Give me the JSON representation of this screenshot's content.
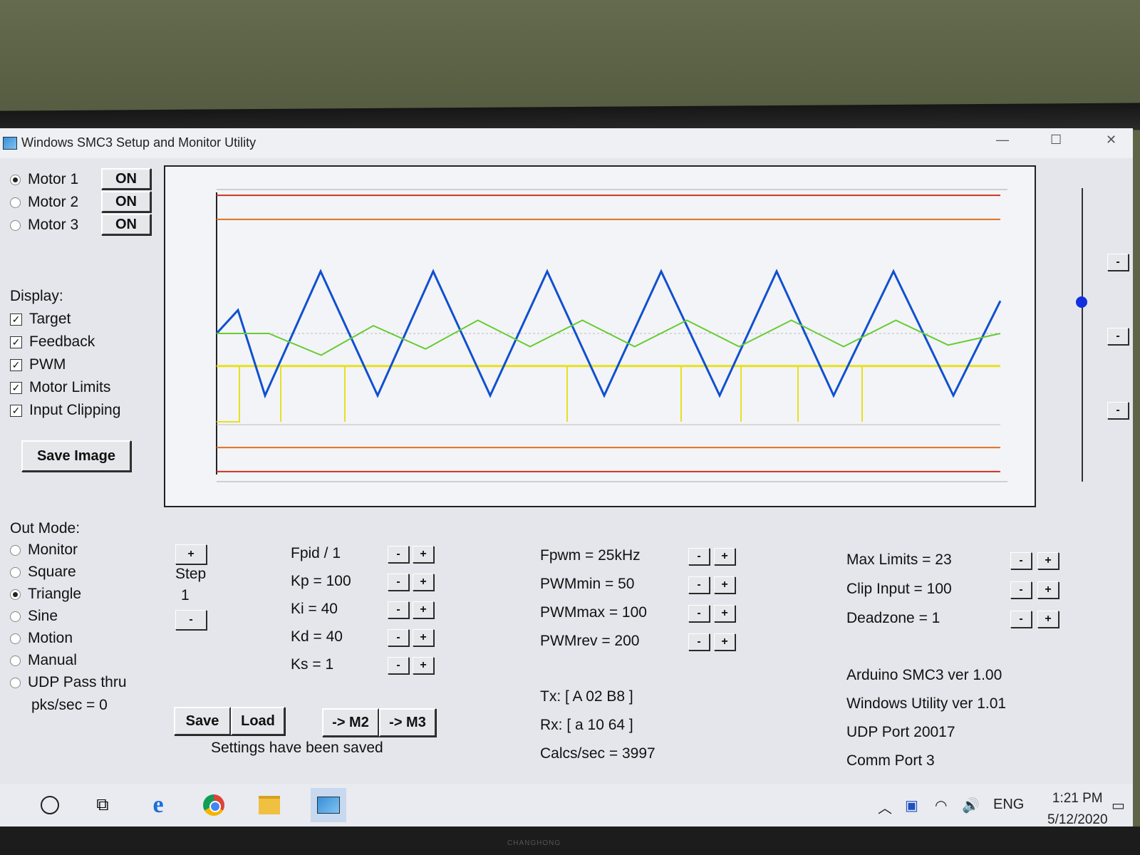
{
  "window": {
    "title": "Windows SMC3 Setup and Monitor Utility"
  },
  "motors": [
    {
      "label": "Motor 1",
      "selected": true,
      "button": "ON"
    },
    {
      "label": "Motor 2",
      "selected": false,
      "button": "ON"
    },
    {
      "label": "Motor 3",
      "selected": false,
      "button": "ON"
    }
  ],
  "display": {
    "heading": "Display:",
    "options": [
      {
        "label": "Target",
        "checked": true
      },
      {
        "label": "Feedback",
        "checked": true
      },
      {
        "label": "PWM",
        "checked": true
      },
      {
        "label": "Motor Limits",
        "checked": true
      },
      {
        "label": "Input Clipping",
        "checked": true
      }
    ],
    "save_image": "Save Image"
  },
  "out_mode": {
    "heading": "Out Mode:",
    "options": [
      {
        "label": "Monitor",
        "selected": false
      },
      {
        "label": "Square",
        "selected": false
      },
      {
        "label": "Triangle",
        "selected": true
      },
      {
        "label": "Sine",
        "selected": false
      },
      {
        "label": "Motion",
        "selected": false
      },
      {
        "label": "Manual",
        "selected": false
      },
      {
        "label": "UDP Pass thru",
        "selected": false
      }
    ],
    "pks": "pks/sec = 0"
  },
  "step": {
    "plus": "+",
    "label": "Step",
    "value": "1",
    "minus": "-"
  },
  "pid": [
    "Fpid / 1",
    "Kp = 100",
    "Ki = 40",
    "Kd = 40",
    "Ks = 1"
  ],
  "pwm": [
    "Fpwm = 25kHz",
    "PWMmin = 50",
    "PWMmax = 100",
    "PWMrev = 200"
  ],
  "limits": [
    "Max Limits = 23",
    "Clip Input = 100",
    "Deadzone = 1"
  ],
  "controls": {
    "minus": "-",
    "plus": "+"
  },
  "buttons": {
    "save": "Save",
    "load": "Load",
    "m2": "-> M2",
    "m3": "-> M3"
  },
  "status": "Settings have been saved",
  "comms": {
    "tx": "Tx: [ A 02 B8 ]",
    "rx": "Rx: [ a 10 64 ]",
    "calcs": "Calcs/sec = 3997"
  },
  "info": [
    "Arduino SMC3 ver 1.00",
    "Windows Utility ver 1.01",
    "UDP Port 20017",
    "Comm Port 3"
  ],
  "chart_data": {
    "type": "line",
    "series": [
      {
        "color": "#1050d0",
        "values": [
          0.0,
          0.3,
          -0.8,
          0.8,
          -0.8,
          0.8,
          -0.8,
          0.8,
          -0.8,
          0.8,
          -0.8,
          0.8,
          -0.8,
          0.42
        ]
      },
      {
        "color": "#66cc33",
        "values": [
          0.0,
          0.0,
          -0.28,
          0.1,
          -0.2,
          0.17,
          -0.17,
          0.17,
          -0.17,
          0.17,
          -0.17,
          0.17,
          -0.17,
          0.17,
          -0.15,
          0.0
        ]
      }
    ],
    "ylim": [
      -1,
      1
    ],
    "limit_lines": {
      "motor_limit": "#d03020",
      "input_clipping": "#e07020"
    }
  },
  "taskbar": {
    "time": "1:21 PM",
    "date": "5/12/2020",
    "lang": "ENG"
  }
}
